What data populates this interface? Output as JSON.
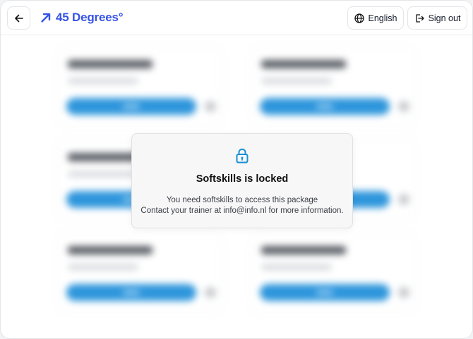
{
  "header": {
    "back_icon": "arrow-left-icon",
    "logo_icon": "arrow-up-right-icon",
    "logo_text": "45 Degrees°",
    "brand_color": "#3653e6",
    "language_icon": "globe-icon",
    "language_label": "English",
    "signout_icon": "sign-out-icon",
    "signout_label": "Sign out"
  },
  "modal": {
    "icon": "lock-icon",
    "icon_color": "#1a8fd6",
    "title": "Softskills is locked",
    "line1": "You need softskills to access this package",
    "line2": "Contact your trainer at info@info.nl for more information."
  },
  "background": {
    "accent_color": "#2e96dc",
    "blurred": true
  }
}
